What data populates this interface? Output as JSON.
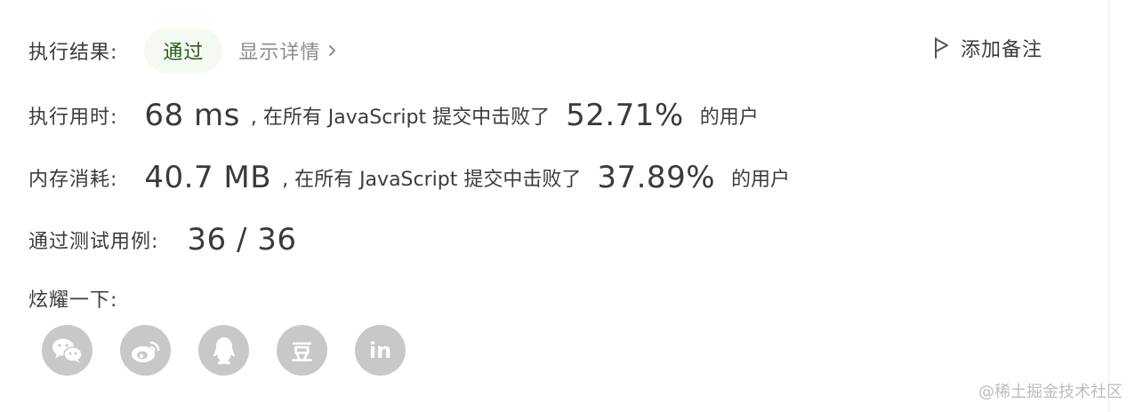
{
  "result": {
    "label": "执行结果:",
    "status": "通过",
    "detail_link": "显示详情",
    "add_note": "添加备注"
  },
  "runtime": {
    "label": "执行用时:",
    "value": "68 ms",
    "text": ", 在所有 JavaScript 提交中击败了",
    "percent": "52.71%",
    "suffix": "的用户"
  },
  "memory": {
    "label": "内存消耗:",
    "value": "40.7 MB",
    "text": ", 在所有 JavaScript 提交中击败了",
    "percent": "37.89%",
    "suffix": "的用户"
  },
  "tests": {
    "label": "通过测试用例:",
    "value": "36 / 36"
  },
  "share": {
    "label": "炫耀一下:",
    "icons": [
      "wechat-icon",
      "weibo-icon",
      "qq-icon",
      "douban-icon",
      "linkedin-icon"
    ],
    "douban_glyph": "豆",
    "linkedin_glyph": "in"
  },
  "watermark": "@稀土掘金技术社区",
  "colors": {
    "pass_bg": "#f4faf1",
    "pass_text": "#2d5a1f",
    "social_bg": "#c8c8c8"
  }
}
